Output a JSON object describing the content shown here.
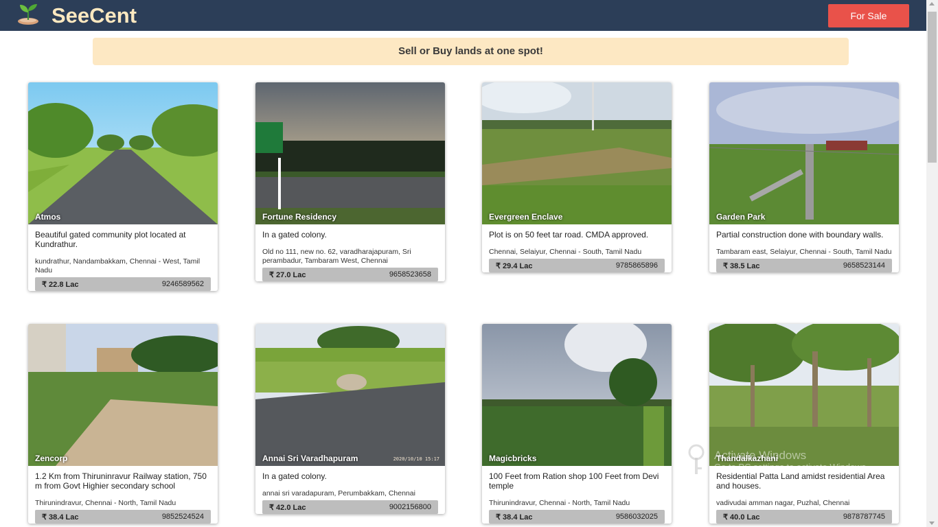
{
  "app": {
    "brand": "SeeCent",
    "for_sale_label": "For Sale"
  },
  "banner": {
    "text": "Sell or Buy lands at one spot!"
  },
  "listings": [
    {
      "title": "Atmos",
      "description": "Beautiful gated community plot located at Kundrathur.",
      "location": "kundrathur, Nandambakkam, Chennai - West, Tamil Nadu",
      "price": "₹ 22.8 Lac",
      "phone": "9246589562"
    },
    {
      "title": "Fortune Residency",
      "description": "In a gated colony.",
      "location": "Old no 111, new no. 62, varadharajapuram, Sri perambadur, Tambaram West, Chennai",
      "price": "₹ 27.0 Lac",
      "phone": "9658523658"
    },
    {
      "title": "Evergreen Enclave",
      "description": "Plot is on 50 feet tar road. CMDA approved.",
      "location": "Chennai, Selaiyur, Chennai - South, Tamil Nadu",
      "price": "₹ 29.4 Lac",
      "phone": "9785865896"
    },
    {
      "title": "Garden Park",
      "description": "Partial construction done with boundary walls.",
      "location": "Tambaram east, Selaiyur, Chennai - South, Tamil Nadu",
      "price": "₹ 38.5 Lac",
      "phone": "9658523144"
    },
    {
      "title": "Zencorp",
      "description": "1.2 Km from Thiruninravur Railway station, 750 m from Govt Highier secondary school",
      "location": "Thirunindravur, Chennai - North, Tamil Nadu",
      "price": "₹ 38.4 Lac",
      "phone": "9852524524"
    },
    {
      "title": "Annai Sri Varadhapuram",
      "description": "In a gated colony.",
      "location": "annai sri varadapuram, Perumbakkam, Chennai",
      "price": "₹ 42.0 Lac",
      "phone": "9002156800",
      "photo_stamp": "2020/10/10  15:17"
    },
    {
      "title": "Magicbricks",
      "description": "100 Feet from Ration shop 100 Feet from Devi temple",
      "location": "Thirunindravur, Chennai - North, Tamil Nadu",
      "price": "₹ 38.4 Lac",
      "phone": "9586032025"
    },
    {
      "title": "Thandalkazhani",
      "description": "Residential Patta Land amidst residential Area and houses.",
      "location": "vadivudai amman nagar, Puzhal, Chennai",
      "price": "₹ 40.0 Lac",
      "phone": "9878787745"
    }
  ],
  "windows_watermark": {
    "title": "Activate Windows",
    "subtitle": "Go to PC settings to activate Windows."
  },
  "colors": {
    "navbar": "#2c3e58",
    "brand_text": "#fde8c0",
    "for_sale_button": "#e9524a",
    "banner_bg": "#fde8c3",
    "price_bar": "#bdbdbd"
  },
  "icons": {
    "logo": "seedling-in-pot-icon",
    "watermark": "key-icon"
  }
}
